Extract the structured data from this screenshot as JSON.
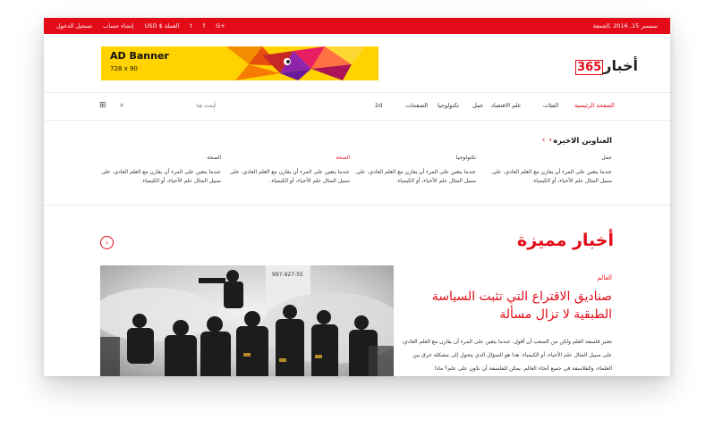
{
  "topbar": {
    "date": "سبتمبر 15, 2016 ,الجمعة",
    "currency": "USD $ العملة",
    "social": [
      "f",
      "t",
      "G+"
    ],
    "login": "تسجيل الدخول",
    "register": "إنشاء حساب"
  },
  "logo": {
    "number": "365",
    "text": "أخبار"
  },
  "ad": {
    "title": "AD Banner",
    "size": "728 x 90"
  },
  "nav": {
    "items": [
      "الصفحة الرئيسية",
      "الفئات",
      "علم الاقتصاد",
      "عمل",
      "تكنولوجيا",
      "الصفحات",
      "2d"
    ],
    "search_placeholder": "ابحث هنا"
  },
  "latest": {
    "title": "العناوين الاخيره",
    "columns": [
      {
        "category": "عمل",
        "text": "عندما يتعين على المرء أن يقارن مع العلم العادي، على سبيل المثال علم الأحياء، أو الكيمياء."
      },
      {
        "category": "تكنولوجيا",
        "text": "عندما يتعين على المرء أن يقارن مع العلم العادي، على سبيل المثال علم الأحياء، أو الكيمياء."
      },
      {
        "category": "الصحة",
        "text": "عندما يتعين على المرء أن يقارن مع العلم العادي، على سبيل المثال علم الأحياء، أو الكيمياء."
      },
      {
        "category": "الصحة",
        "text": "عندما يتعين على المرء أن يقارن مع العلم العادي، على سبيل المثال علم الأحياء، أو الكيمياء."
      }
    ]
  },
  "featured": {
    "title": "أخبار مميزة",
    "article": {
      "category": "العالم",
      "title": "صناديق الاقتراع التي تثبت السياسة الطبقية لا تزال مسألة",
      "body": "تعتبر فلسفة العلم ولكن من الصعب أن أقول. عندما يتعين على المرء أن يقارن مع العلم العادي، على سبيل المثال علم الأحياء، أو الكيمياء. هذا هو السؤال الذي يتحول إلى مشكلة حرق بين العلماء، والفلاسفة في جميع أنحاء العالم. يمكن للفلسفة أن تكون على علم؟ ماذا"
    },
    "photo_caption_text": "997-927-55"
  },
  "colors": {
    "accent": "#e30b17",
    "ad_bg": "#ffd200"
  }
}
